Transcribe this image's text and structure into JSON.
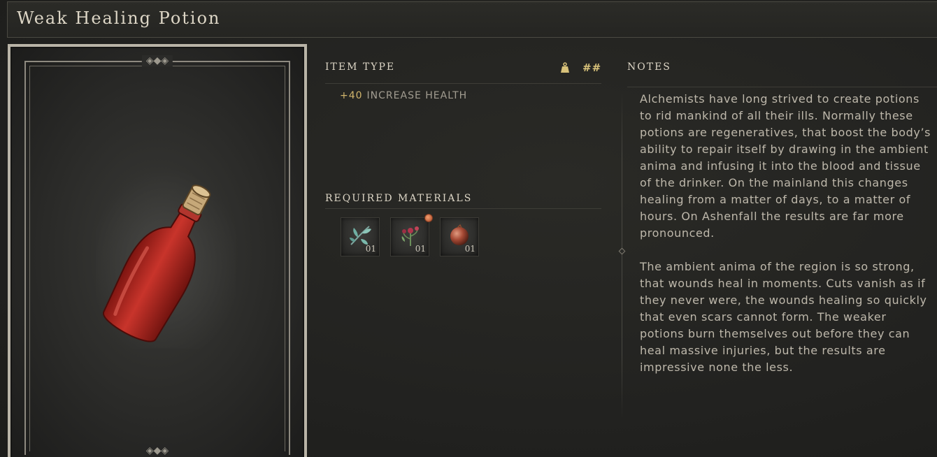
{
  "item": {
    "title": "Weak Healing Potion"
  },
  "item_type": {
    "label": "ITEM TYPE",
    "weight_value": "##",
    "weight_icon": "weight-icon",
    "stat": {
      "value": "+40",
      "label": "INCREASE HEALTH"
    }
  },
  "materials": {
    "label": "REQUIRED MATERIALS",
    "items": [
      {
        "icon": "herb-leaf-icon",
        "quantity": "01"
      },
      {
        "icon": "red-flower-icon",
        "quantity": "01",
        "badge": true
      },
      {
        "icon": "red-orb-icon",
        "quantity": "01"
      }
    ]
  },
  "notes": {
    "label": "NOTES",
    "paragraphs": [
      "Alchemists have long strived to create potions to rid mankind of all their ills. Normally these potions are regeneratives, that boost the body’s ability to repair itself by drawing in the ambient anima and infusing it into the blood and tissue of the drinker. On the mainland this changes healing from a matter of days, to a matter of hours. On Ashenfall the results are far more pronounced.",
      "The ambient anima of the region is so strong, that wounds heal in moments. Cuts vanish as if they never were, the wounds healing so quickly that even scars cannot form. The weaker potions burn themselves out before they can heal massive injuries, but the results are impressive none the less."
    ]
  },
  "colors": {
    "accent_gold": "#d1b56c",
    "potion_red": "#b3251f",
    "badge_orange": "#e0875a"
  }
}
